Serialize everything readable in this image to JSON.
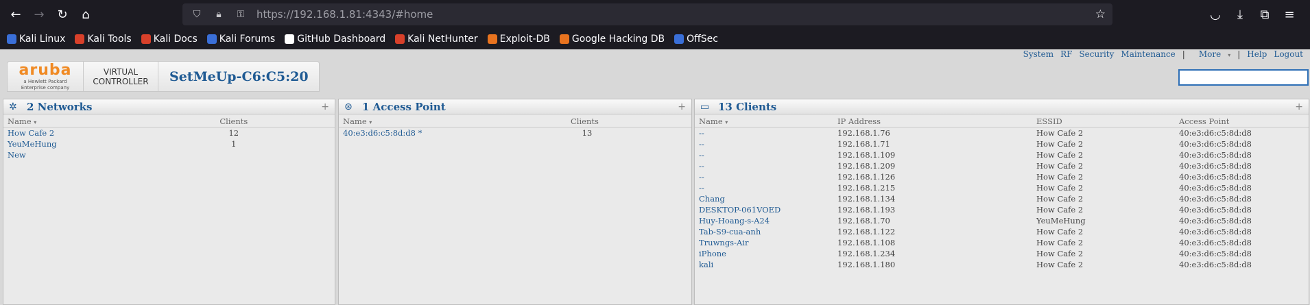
{
  "browser": {
    "url_host": "https://192.168.1.81",
    "url_rest": ":4343/#home",
    "bookmarks": [
      {
        "label": "Kali Linux",
        "icon": "kali-icon",
        "color": "#3a6fd8"
      },
      {
        "label": "Kali Tools",
        "icon": "kali-tools-icon",
        "color": "#d8402a"
      },
      {
        "label": "Kali Docs",
        "icon": "kali-docs-icon",
        "color": "#d8402a"
      },
      {
        "label": "Kali Forums",
        "icon": "kali-forums-icon",
        "color": "#3a6fd8"
      },
      {
        "label": "GitHub Dashboard",
        "icon": "github-icon",
        "color": "#ffffff"
      },
      {
        "label": "Kali NetHunter",
        "icon": "nethunter-icon",
        "color": "#d8402a"
      },
      {
        "label": "Exploit-DB",
        "icon": "exploit-db-icon",
        "color": "#e8731f"
      },
      {
        "label": "Google Hacking DB",
        "icon": "ghdb-icon",
        "color": "#e8731f"
      },
      {
        "label": "OffSec",
        "icon": "offsec-icon",
        "color": "#3a6fd8"
      }
    ]
  },
  "nav": {
    "system": "System",
    "rf": "RF",
    "security": "Security",
    "maintenance": "Maintenance",
    "more": "More",
    "help": "Help",
    "logout": "Logout"
  },
  "brand": {
    "logo": "aruba",
    "logo_sub1": "a Hewlett Packard",
    "logo_sub2": "Enterprise company",
    "vc_line1": "VIRTUAL",
    "vc_line2": "CONTROLLER",
    "name": "SetMeUp-C6:C5:20"
  },
  "networks": {
    "title": "2 Networks",
    "col_name": "Name",
    "col_clients": "Clients",
    "rows": [
      {
        "name": "How Cafe 2",
        "clients": "12"
      },
      {
        "name": "YeuMeHung",
        "clients": "1"
      },
      {
        "name": "New",
        "clients": ""
      }
    ]
  },
  "access_points": {
    "title": "1 Access Point",
    "col_name": "Name",
    "col_clients": "Clients",
    "rows": [
      {
        "name": "40:e3:d6:c5:8d:d8 *",
        "clients": "13"
      }
    ]
  },
  "clients": {
    "title": "13 Clients",
    "col_name": "Name",
    "col_ip": "IP Address",
    "col_essid": "ESSID",
    "col_ap": "Access Point",
    "rows": [
      {
        "name": "--",
        "ip": "192.168.1.76",
        "essid": "How Cafe 2",
        "ap": "40:e3:d6:c5:8d:d8"
      },
      {
        "name": "--",
        "ip": "192.168.1.71",
        "essid": "How Cafe 2",
        "ap": "40:e3:d6:c5:8d:d8"
      },
      {
        "name": "--",
        "ip": "192.168.1.109",
        "essid": "How Cafe 2",
        "ap": "40:e3:d6:c5:8d:d8"
      },
      {
        "name": "--",
        "ip": "192.168.1.209",
        "essid": "How Cafe 2",
        "ap": "40:e3:d6:c5:8d:d8"
      },
      {
        "name": "--",
        "ip": "192.168.1.126",
        "essid": "How Cafe 2",
        "ap": "40:e3:d6:c5:8d:d8"
      },
      {
        "name": "--",
        "ip": "192.168.1.215",
        "essid": "How Cafe 2",
        "ap": "40:e3:d6:c5:8d:d8"
      },
      {
        "name": "Chang",
        "ip": "192.168.1.134",
        "essid": "How Cafe 2",
        "ap": "40:e3:d6:c5:8d:d8"
      },
      {
        "name": "DESKTOP-061VOED",
        "ip": "192.168.1.193",
        "essid": "How Cafe 2",
        "ap": "40:e3:d6:c5:8d:d8"
      },
      {
        "name": "Huy-Hoang-s-A24",
        "ip": "192.168.1.70",
        "essid": "YeuMeHung",
        "ap": "40:e3:d6:c5:8d:d8"
      },
      {
        "name": "Tab-S9-cua-anh",
        "ip": "192.168.1.122",
        "essid": "How Cafe 2",
        "ap": "40:e3:d6:c5:8d:d8"
      },
      {
        "name": "Truwngs-Air",
        "ip": "192.168.1.108",
        "essid": "How Cafe 2",
        "ap": "40:e3:d6:c5:8d:d8"
      },
      {
        "name": "iPhone",
        "ip": "192.168.1.234",
        "essid": "How Cafe 2",
        "ap": "40:e3:d6:c5:8d:d8"
      },
      {
        "name": "kali",
        "ip": "192.168.1.180",
        "essid": "How Cafe 2",
        "ap": "40:e3:d6:c5:8d:d8"
      }
    ]
  }
}
